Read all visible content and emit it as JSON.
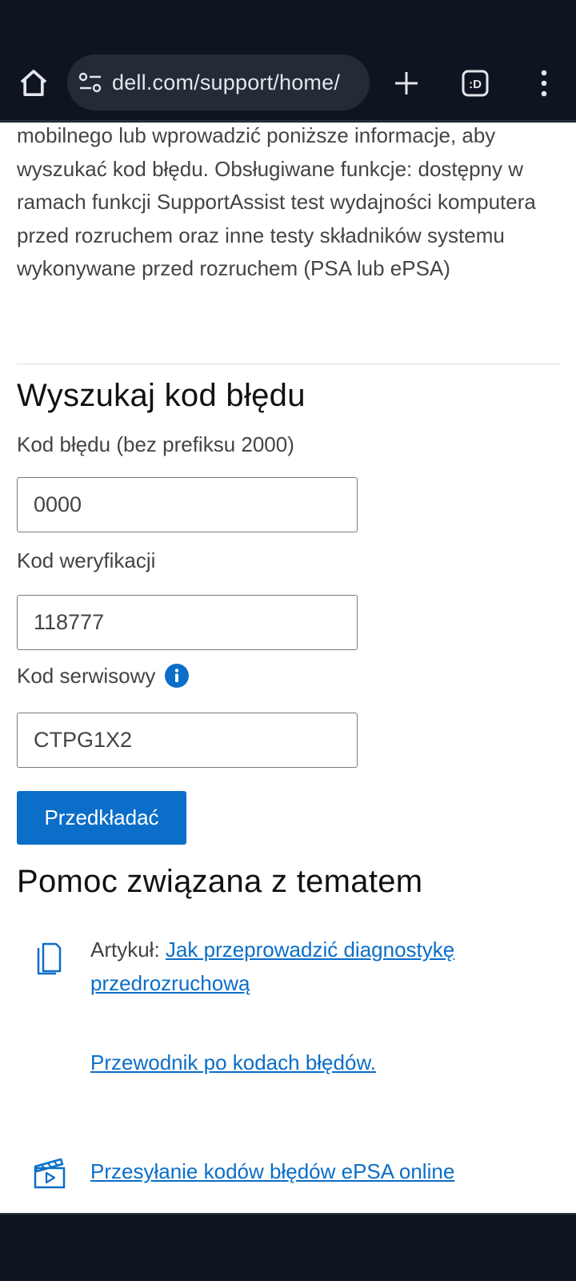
{
  "browser": {
    "url": "dell.com/support/home/",
    "tabs_label": ":D"
  },
  "intro_text": "mobilnego lub wprowadzić poniższe informacje, aby wyszukać kod błędu. Obsługiwane funkcje: dostępny w ramach funkcji SupportAssist test wydajności komputera przed rozruchem oraz inne testy składników systemu wykonywane przed rozruchem (PSA lub ePSA)",
  "search": {
    "heading": "Wyszukaj kod błędu",
    "error_code_label": "Kod błędu (bez prefiksu 2000)",
    "error_code_value": "0000",
    "verification_label": "Kod weryfikacji",
    "verification_value": "118777",
    "service_tag_label": "Kod serwisowy",
    "service_tag_value": "CTPG1X2",
    "submit_label": "Przedkładać"
  },
  "help": {
    "heading": "Pomoc związana z tematem",
    "article_prefix": "Artykuł: ",
    "article_link": "Jak przeprowadzić diagnostykę przedrozruchową",
    "guide_link": "Przewodnik po kodach błędów.",
    "video_link": "Przesyłanie kodów błędów ePSA online"
  },
  "colors": {
    "accent": "#0b6ec9",
    "chrome_bg": "#0f1520",
    "url_bar_bg": "#232b37"
  },
  "icons": [
    "home-icon",
    "site-settings-icon",
    "plus-icon",
    "tab-switcher-icon",
    "more-vert-icon",
    "info-icon",
    "document-icon",
    "video-icon"
  ]
}
